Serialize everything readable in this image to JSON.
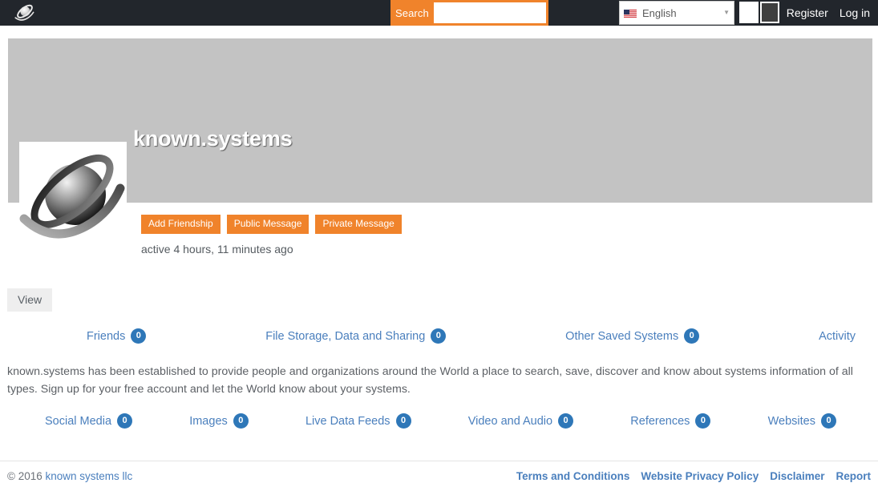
{
  "topbar": {
    "logo_icon": "orbital-sphere-logo-icon",
    "search": {
      "label": "Search",
      "value": "",
      "placeholder": ""
    },
    "language": {
      "flag_icon": "us-flag-icon",
      "selected": "English",
      "caret_icon": "chevron-down-icon",
      "options": [
        "English"
      ]
    },
    "theme_swatches": [
      {
        "name": "light",
        "color": "#ffffff"
      },
      {
        "name": "dark",
        "color": "#3f3f3f"
      }
    ],
    "register_label": "Register",
    "login_label": "Log in"
  },
  "profile": {
    "title": "known.systems",
    "avatar_icon": "orbital-sphere-avatar-icon",
    "buttons": [
      {
        "label": "Add Friendship",
        "name": "add-friendship-button"
      },
      {
        "label": "Public Message",
        "name": "public-message-button"
      },
      {
        "label": "Private Message",
        "name": "private-message-button"
      }
    ],
    "last_active": "active 4 hours, 11 minutes ago",
    "view_tab_label": "View"
  },
  "nav_row_1": [
    {
      "label": "Friends",
      "count": "0",
      "has_badge": true
    },
    {
      "label": "File Storage, Data and Sharing",
      "count": "0",
      "has_badge": true
    },
    {
      "label": "Other Saved Systems",
      "count": "0",
      "has_badge": true
    },
    {
      "label": "Activity",
      "count": "",
      "has_badge": false
    }
  ],
  "intro": "known.systems has been established to provide people and organizations around the World a place to search, save, discover and know about systems information of all types. Sign up for your free account and let the World know about your systems.",
  "nav_row_2": [
    {
      "label": "Social Media",
      "count": "0",
      "has_badge": true
    },
    {
      "label": "Images",
      "count": "0",
      "has_badge": true
    },
    {
      "label": "Live Data Feeds",
      "count": "0",
      "has_badge": true
    },
    {
      "label": "Video and Audio",
      "count": "0",
      "has_badge": true
    },
    {
      "label": "References",
      "count": "0",
      "has_badge": true
    },
    {
      "label": "Websites",
      "count": "0",
      "has_badge": true
    }
  ],
  "footer": {
    "copyright_prefix": "© 2016 ",
    "company_link": "known systems llc",
    "links": [
      "Terms and Conditions",
      "Website Privacy Policy",
      "Disclaimer",
      "Report"
    ]
  },
  "colors": {
    "topbar_bg": "#22262c",
    "accent_orange": "#f0832b",
    "link_blue": "#4a7fbd",
    "badge_blue": "#2e77b8",
    "banner_gray": "#c3c3c3"
  }
}
